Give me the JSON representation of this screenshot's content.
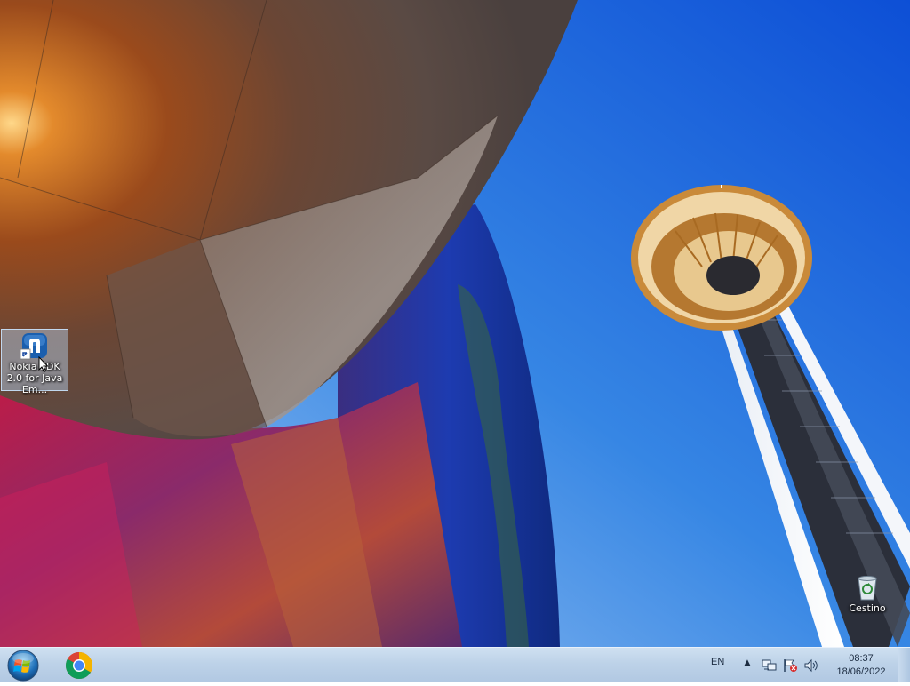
{
  "desktop": {
    "icons": [
      {
        "label": "Nokia SDK 2.0 for Java Em...",
        "icon": "nokia-sdk-icon",
        "selected": true
      },
      {
        "label": "Cestino",
        "icon": "recycle-bin-icon",
        "selected": false
      }
    ]
  },
  "taskbar": {
    "start_icon": "windows-logo-icon",
    "pinned": [
      {
        "icon": "chrome-icon"
      }
    ],
    "tray": {
      "language": "EN",
      "icons": [
        "show-hidden-icons-chevron-icon",
        "network-icon",
        "action-center-flag-icon",
        "volume-icon"
      ],
      "time": "08:37",
      "date": "18/06/2022"
    }
  },
  "colors": {
    "taskbar": "#bdd2e8",
    "sky": "#2f7de3",
    "selection": "#b9d7f5"
  }
}
